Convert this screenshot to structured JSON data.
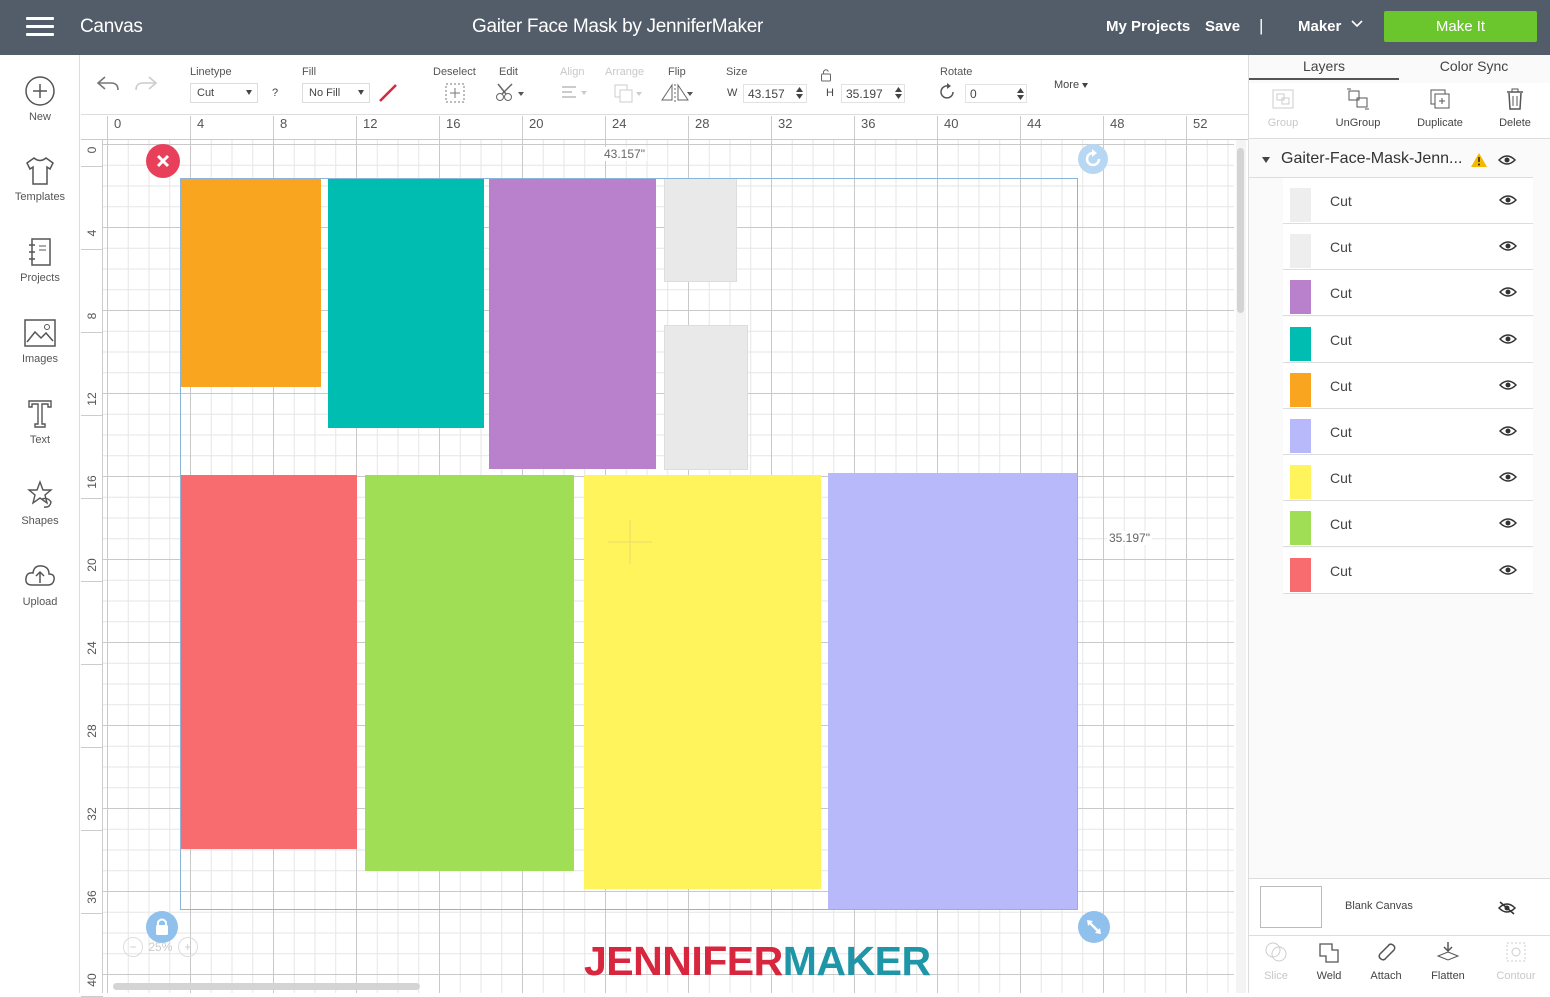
{
  "topbar": {
    "app_title": "Canvas",
    "doc_title": "Gaiter Face Mask by JenniferMaker",
    "my_projects": "My Projects",
    "save": "Save",
    "separator": "|",
    "machine": "Maker",
    "make_it": "Make It"
  },
  "leftnav": [
    {
      "label": "New",
      "icon": "plus-circle-icon"
    },
    {
      "label": "Templates",
      "icon": "shirt-icon"
    },
    {
      "label": "Projects",
      "icon": "notebook-icon"
    },
    {
      "label": "Images",
      "icon": "image-icon"
    },
    {
      "label": "Text",
      "icon": "text-icon"
    },
    {
      "label": "Shapes",
      "icon": "shapes-icon"
    },
    {
      "label": "Upload",
      "icon": "cloud-upload-icon"
    }
  ],
  "toolbar": {
    "linetype_label": "Linetype",
    "linetype_value": "Cut",
    "linetype_help": "?",
    "fill_label": "Fill",
    "fill_value": "No Fill",
    "deselect_label": "Deselect",
    "edit_label": "Edit",
    "align_label": "Align",
    "arrange_label": "Arrange",
    "flip_label": "Flip",
    "size_label": "Size",
    "w_label": "W",
    "w_value": "43.157",
    "h_label": "H",
    "h_value": "35.197",
    "rotate_label": "Rotate",
    "rotate_value": "0",
    "more_label": "More"
  },
  "ruler": {
    "top": [
      "0",
      "4",
      "8",
      "12",
      "16",
      "20",
      "24",
      "28",
      "32",
      "36",
      "40",
      "44",
      "48",
      "52"
    ],
    "left": [
      "0",
      "4",
      "8",
      "12",
      "16",
      "20",
      "24",
      "28",
      "32",
      "36",
      "40"
    ]
  },
  "canvas": {
    "width_dim": "43.157\"",
    "height_dim": "35.197\"",
    "zoom": "25%",
    "shapes": [
      {
        "name": "orange",
        "color": "#f9a51f"
      },
      {
        "name": "teal",
        "color": "#00bdb1"
      },
      {
        "name": "purple",
        "color": "#b980cb"
      },
      {
        "name": "light-gray-top",
        "color": "#e9e9e9"
      },
      {
        "name": "light-gray-mid",
        "color": "#e9e9e9"
      },
      {
        "name": "red",
        "color": "#f86b6f"
      },
      {
        "name": "green",
        "color": "#9fde55"
      },
      {
        "name": "yellow",
        "color": "#fff45c"
      },
      {
        "name": "lavender",
        "color": "#b8b9fa"
      }
    ]
  },
  "watermark": {
    "part1": "JENNIFER",
    "part2": "MAKER"
  },
  "panel": {
    "tabs": [
      "Layers",
      "Color Sync"
    ],
    "actions": [
      {
        "label": "Group",
        "enabled": false
      },
      {
        "label": "UnGroup",
        "enabled": true
      },
      {
        "label": "Duplicate",
        "enabled": true
      },
      {
        "label": "Delete",
        "enabled": true
      }
    ],
    "group_name": "Gaiter-Face-Mask-Jenn...",
    "layers": [
      {
        "label": "Cut",
        "color": "#eeeeee"
      },
      {
        "label": "Cut",
        "color": "#eeeeee"
      },
      {
        "label": "Cut",
        "color": "#b980cb"
      },
      {
        "label": "Cut",
        "color": "#00bdb1"
      },
      {
        "label": "Cut",
        "color": "#f9a51f"
      },
      {
        "label": "Cut",
        "color": "#b8b9fa"
      },
      {
        "label": "Cut",
        "color": "#fff45c"
      },
      {
        "label": "Cut",
        "color": "#9fde55"
      },
      {
        "label": "Cut",
        "color": "#f86b6f"
      }
    ],
    "blank_canvas": "Blank Canvas",
    "bottom_actions": [
      {
        "label": "Slice",
        "enabled": false
      },
      {
        "label": "Weld",
        "enabled": true
      },
      {
        "label": "Attach",
        "enabled": true
      },
      {
        "label": "Flatten",
        "enabled": true
      },
      {
        "label": "Contour",
        "enabled": false
      }
    ]
  },
  "colors": {
    "topbar": "#535c69",
    "make_it": "#6ac62c",
    "selection": "#8ab4d8",
    "handle_blue": "#8fc1ec",
    "handle_red": "#e8405a"
  }
}
